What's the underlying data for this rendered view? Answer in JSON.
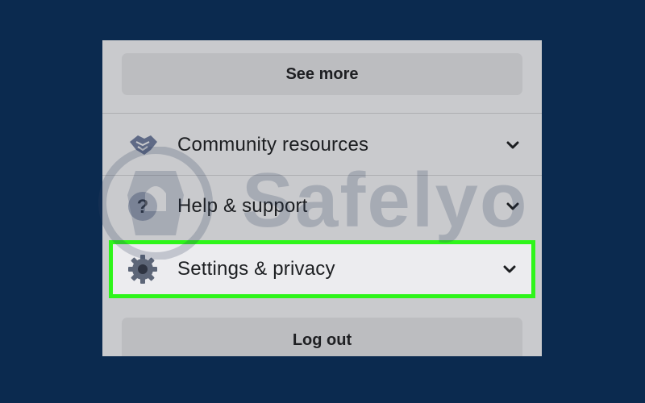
{
  "menu": {
    "see_more_label": "See more",
    "items": [
      {
        "label": "Community resources",
        "icon": "handshake-icon"
      },
      {
        "label": "Help & support",
        "icon": "question-icon"
      },
      {
        "label": "Settings & privacy",
        "icon": "gear-icon",
        "highlighted": true
      }
    ],
    "logout_label": "Log out"
  },
  "watermark": {
    "text": "Safelyo"
  },
  "colors": {
    "background": "#0b2a4f",
    "panel": "#c9cacd",
    "highlight_border": "#2ef51a",
    "highlight_fill": "#ececef"
  }
}
